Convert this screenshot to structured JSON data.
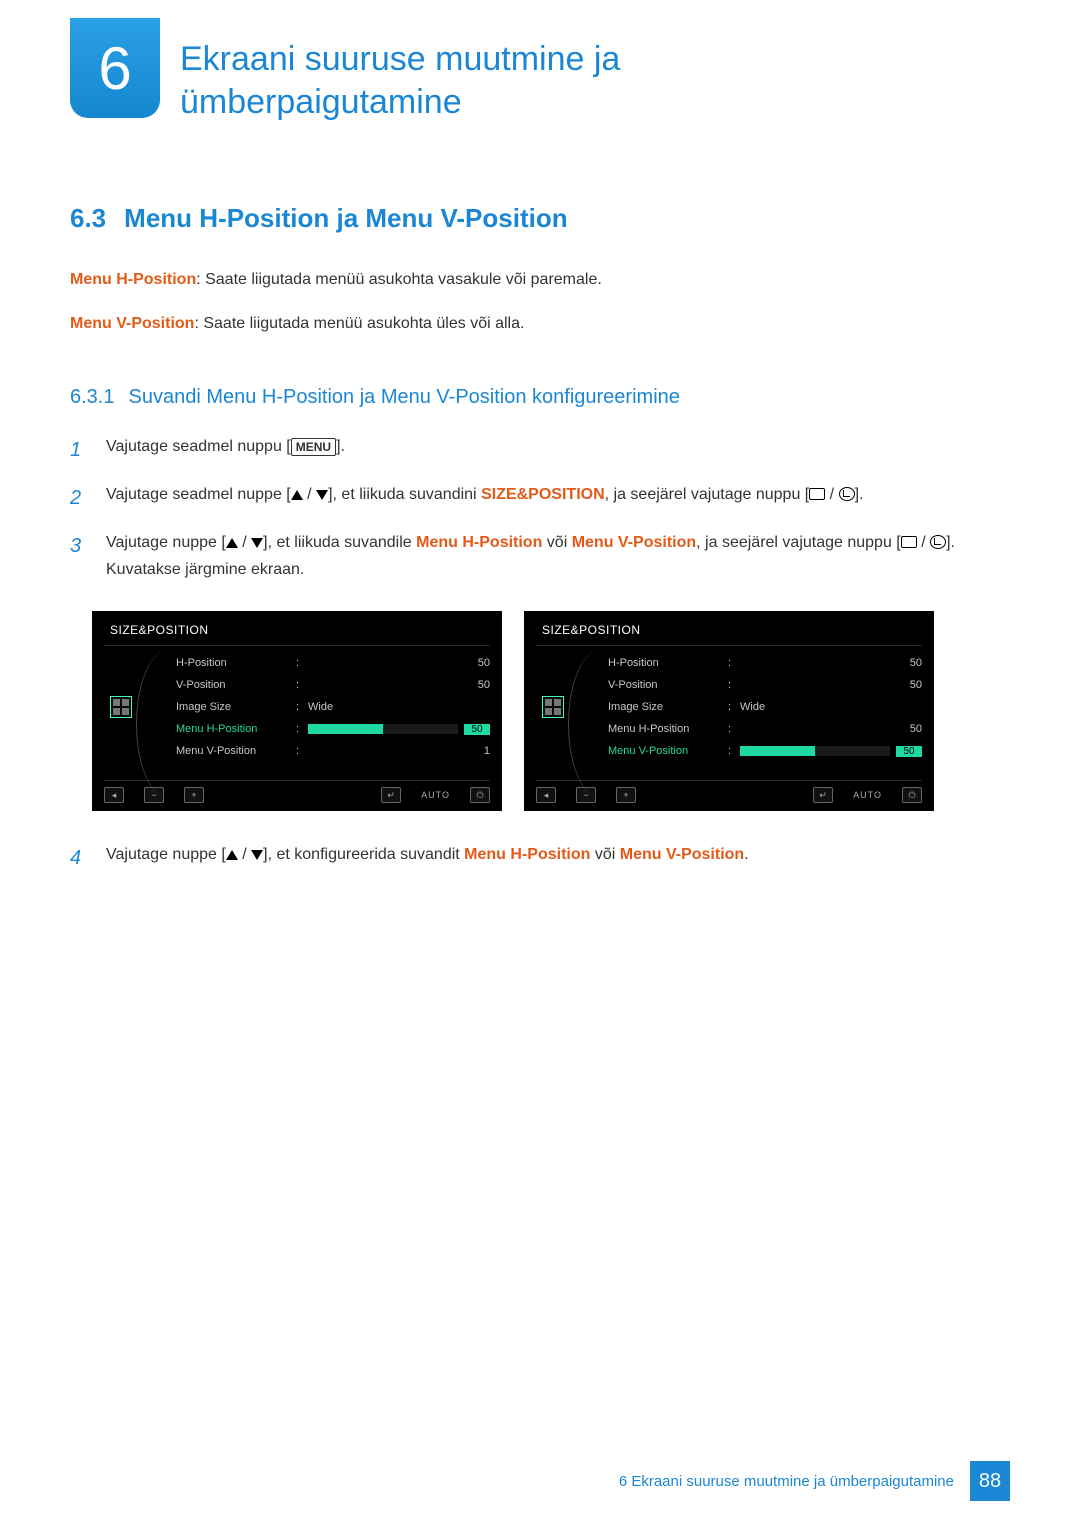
{
  "chapter": {
    "number": "6",
    "title": "Ekraani suuruse muutmine ja ümberpaigutamine"
  },
  "section": {
    "number": "6.3",
    "title": "Menu H-Position ja Menu V-Position"
  },
  "defs": {
    "h_term": "Menu H-Position",
    "h_text": ": Saate liigutada menüü asukohta vasakule või paremale.",
    "v_term": "Menu V-Position",
    "v_text": ": Saate liigutada menüü asukohta üles või alla."
  },
  "subsection": {
    "number": "6.3.1",
    "title": "Suvandi Menu H-Position ja Menu V-Position konfigureerimine"
  },
  "steps": {
    "s1": {
      "n": "1",
      "a": "Vajutage seadmel nuppu [",
      "menu": "MENU",
      "b": "]."
    },
    "s2": {
      "n": "2",
      "a": "Vajutage seadmel nuppe [",
      "b": "], et liikuda suvandini ",
      "sp": "SIZE&POSITION",
      "c": ", ja seejärel vajutage nuppu [",
      "d": "]."
    },
    "s3": {
      "n": "3",
      "a": "Vajutage nuppe [",
      "b": "], et liikuda suvandile ",
      "h": "Menu H-Position",
      "or": " või ",
      "v": "Menu V-Position",
      "c": ", ja seejärel vajutage nuppu [",
      "d": "]. Kuvatakse järgmine ekraan."
    },
    "s4": {
      "n": "4",
      "a": "Vajutage nuppe [",
      "b": "], et konfigureerida suvandit ",
      "h": "Menu H-Position",
      "or": " või ",
      "v": "Menu V-Position",
      "c": "."
    }
  },
  "osd": {
    "title": "SIZE&POSITION",
    "rows": {
      "h": {
        "label": "H-Position",
        "val": "50"
      },
      "v": {
        "label": "V-Position",
        "val": "50"
      },
      "img": {
        "label": "Image Size",
        "val": "Wide"
      },
      "mh": {
        "label": "Menu H-Position",
        "val": "50"
      },
      "mv": {
        "label": "Menu V-Position",
        "val": "1",
        "val2": "50"
      }
    },
    "auto": "AUTO"
  },
  "footer": {
    "text": "6 Ekraani suuruse muutmine ja ümberpaigutamine",
    "page": "88"
  }
}
